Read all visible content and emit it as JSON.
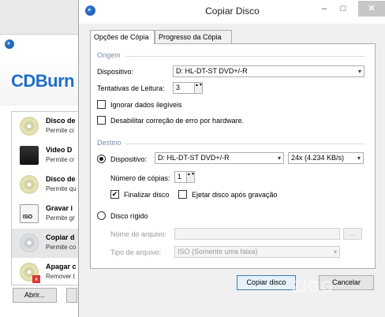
{
  "background_window": {
    "logo_text": "CDBurn",
    "items": [
      {
        "title": "Disco de",
        "subtitle": "Permite cr"
      },
      {
        "title": "Video D",
        "subtitle": "Permite cr"
      },
      {
        "title": "Disco de",
        "subtitle": "Permite qu"
      },
      {
        "title": "Gravar i",
        "subtitle": "Permite gr"
      },
      {
        "title": "Copiar d",
        "subtitle": "Permite co"
      },
      {
        "title": "Apagar c",
        "subtitle": "Remover t"
      }
    ],
    "open_button": "Abrir..."
  },
  "dialog": {
    "title": "Copiar Disco",
    "window_controls": {
      "minimize": "–",
      "maximize": "□",
      "close": "✕"
    },
    "tabs": [
      {
        "label": "Opções de Cópia",
        "active": true
      },
      {
        "label": "Progresso da Cópia",
        "active": false
      }
    ],
    "origin": {
      "group_label": "Origem",
      "device_label": "Dispositivo:",
      "device_value": "D:  HL-DT-ST DVD+/-R",
      "read_attempts_label": "Tentativas de Leitura:",
      "read_attempts_value": "3",
      "ignore_unreadable_label": "Ignorar dados ilegíveis",
      "ignore_unreadable_checked": false,
      "disable_hw_ecc_label": "Desabilitar correção de erro por hardware.",
      "disable_hw_ecc_checked": false
    },
    "destination": {
      "group_label": "Destino",
      "device_label": "Dispositivo:",
      "device_value": "D:  HL-DT-ST DVD+/-R",
      "device_selected": true,
      "speed_value": "24x (4.234 KB/s)",
      "copies_label": "Número de cópias:",
      "copies_value": "1",
      "finalize_label": "Finalizar disco",
      "finalize_checked": true,
      "eject_label": "Ejetar disco após gravação",
      "eject_checked": false,
      "harddisk_label": "Disco rígido",
      "harddisk_selected": false,
      "filename_label": "Nome do  arquivo:",
      "filename_value": "",
      "browse_label": "...",
      "filetype_label": "Tipo de arquivo:",
      "filetype_value": "ISO (Somente uma faixa)"
    },
    "copy_button": "Copiar disco",
    "cancel_button": "Cancelar",
    "arrow_glyph": "▾",
    "spin_glyph": "▲▼",
    "check_glyph": "✔"
  },
  "watermark": "ZIGG",
  "colors": {
    "accent": "#3c7fb1",
    "group_label": "#7a8da8",
    "logo": "#1f6fc4"
  }
}
